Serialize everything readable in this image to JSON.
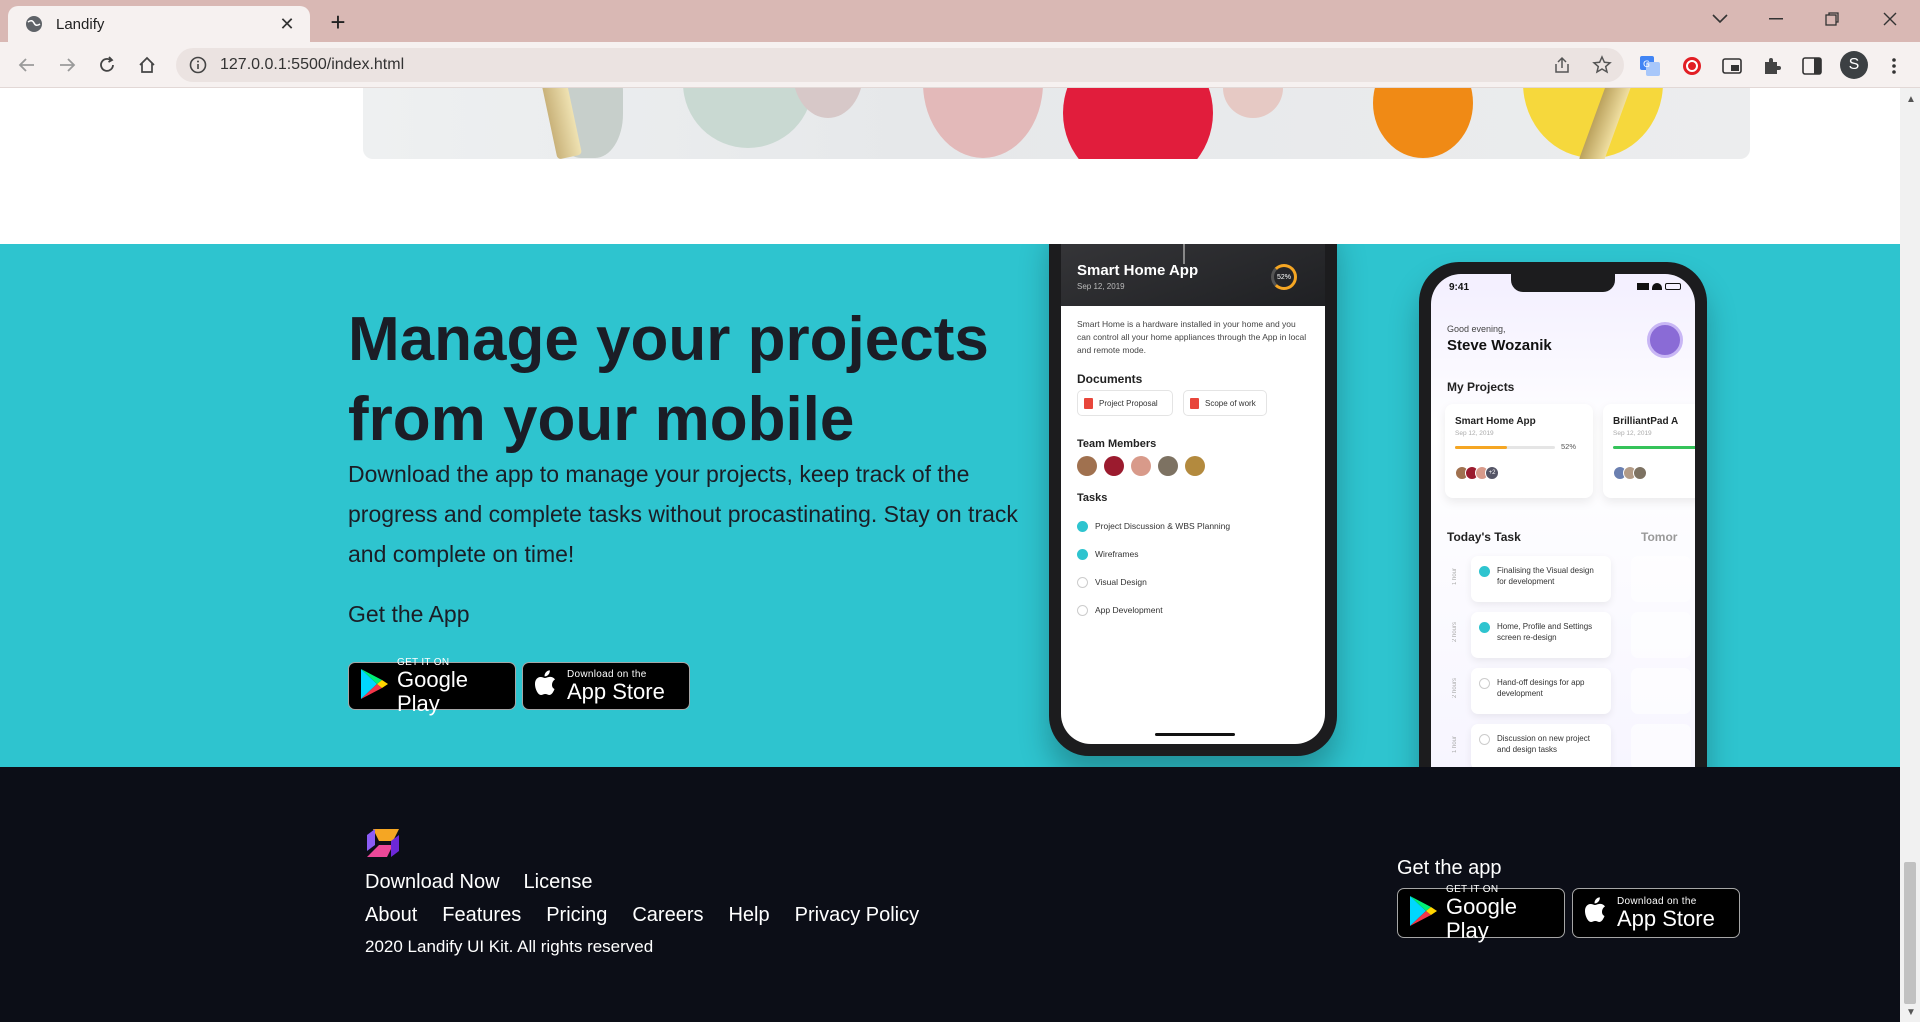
{
  "browser": {
    "tab_title": "Landify",
    "url": "127.0.0.1:5500/index.html",
    "profile_initial": "S"
  },
  "cta": {
    "heading": "Manage your projects from your mobile",
    "description": "Download the app to manage your projects, keep track of the progress and complete tasks without procastinating. Stay on track and complete on time!",
    "get_app_label": "Get the App",
    "google_play": {
      "small": "GET IT ON",
      "big": "Google Play"
    },
    "app_store": {
      "small": "Download on the",
      "big": "App Store"
    }
  },
  "phone_left": {
    "app_title": "Smart Home App",
    "date": "Sep 12, 2019",
    "progress": "52%",
    "description": "Smart Home is a hardware installed in your home and you can control all your home appliances through the App in local and remote mode.",
    "documents_heading": "Documents",
    "documents": [
      "Project Proposal",
      "Scope of work"
    ],
    "team_heading": "Team Members",
    "tasks_heading": "Tasks",
    "tasks": [
      {
        "label": "Project Discussion & WBS Planning",
        "done": true
      },
      {
        "label": "Wireframes",
        "done": true
      },
      {
        "label": "Visual Design",
        "done": false
      },
      {
        "label": "App Development",
        "done": false
      }
    ]
  },
  "phone_right": {
    "time": "9:41",
    "greeting": "Good evening,",
    "name": "Steve Wozanik",
    "projects_heading": "My Projects",
    "project1": {
      "title": "Smart Home App",
      "date": "Sep 12, 2019",
      "progress": "52%",
      "extra": "+2"
    },
    "project2": {
      "title": "BrilliantPad A",
      "date": "Sep 12, 2019"
    },
    "today_heading": "Today's Task",
    "tomorrow_heading": "Tomor",
    "tasks": [
      {
        "duration": "1 hour",
        "label": "Finalising the Visual design for development",
        "done": true
      },
      {
        "duration": "2 hours",
        "label": "Home, Profile and Settings screen re-design",
        "done": true
      },
      {
        "duration": "2 hours",
        "label": "Hand-off desings for app development",
        "done": false
      },
      {
        "duration": "1 hour",
        "label": "Discussion on new project and design tasks",
        "done": false
      }
    ]
  },
  "footer": {
    "links_row1": [
      "Download Now",
      "License"
    ],
    "links_row2": [
      "About",
      "Features",
      "Pricing",
      "Careers",
      "Help",
      "Privacy Policy"
    ],
    "copyright": "2020 Landify UI Kit. All rights reserved",
    "get_app_label": "Get the app",
    "google_play": {
      "small": "GET IT ON",
      "big": "Google Play"
    },
    "app_store": {
      "small": "Download on the",
      "big": "App Store"
    }
  },
  "colors": {
    "tabbar": "#d9b8b4",
    "cta_background": "#2ec4cf",
    "footer_background": "#0c0e17",
    "heading_text": "#1b1d26",
    "accent_green": "#2ec4cf",
    "accent_orange": "#f5a623"
  }
}
